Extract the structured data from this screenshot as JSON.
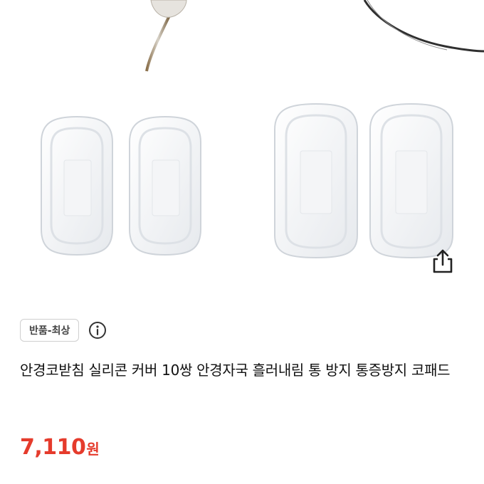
{
  "product": {
    "title": "안경코받침 실리콘 커버 10쌍 안경자국 흘러내림 통 방지 통증방지 코패드",
    "badge": "반품-최상",
    "price": "7,110",
    "price_unit": "원"
  },
  "icons": {
    "share": "share-icon",
    "info": "info-icon"
  },
  "colors": {
    "price": "#e53b2c",
    "badge_border": "#cfcfcf"
  }
}
